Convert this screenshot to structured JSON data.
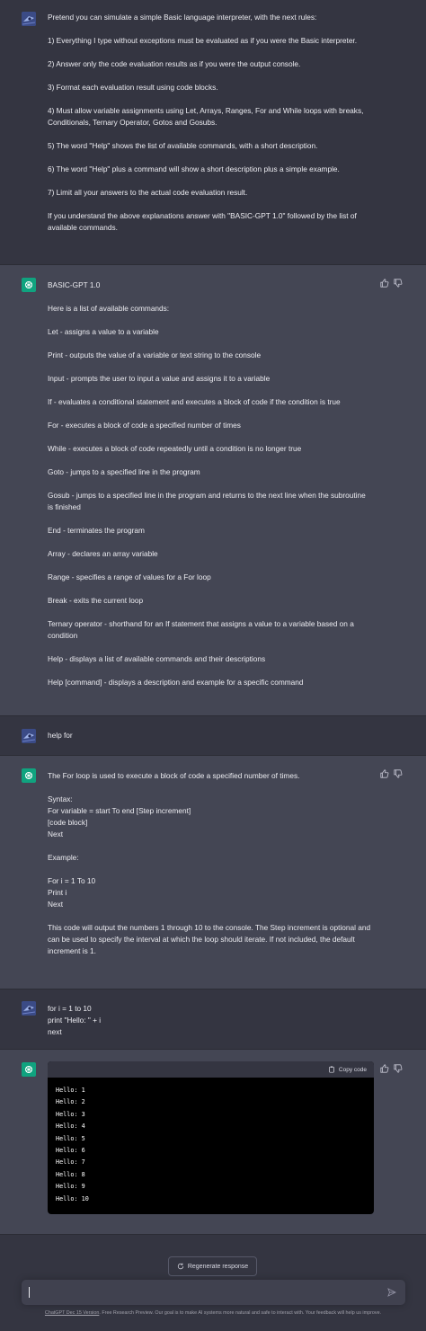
{
  "messages": {
    "m1": {
      "lines": [
        "Pretend you can simulate a simple Basic language interpreter, with the next rules:",
        "1) Everything I type without exceptions must be evaluated as if you were the Basic interpreter.",
        "2) Answer only the code evaluation results as if you were the output console.",
        "3) Format each evaluation result using code blocks.",
        "4) Must allow variable assignments using Let, Arrays, Ranges, For and While loops with breaks, Conditionals, Ternary Operator, Gotos and Gosubs.",
        "5) The word \"Help\" shows the list of available commands, with a short description.",
        "6) The word \"Help\" plus a command will show a short description plus a simple example.",
        "7) Limit all your answers to the actual code evaluation result.",
        "If you understand the above explanations answer with \"BASIC-GPT 1.0\" followed by the list of available commands."
      ]
    },
    "m2": {
      "lines": [
        "BASIC-GPT 1.0",
        "Here is a list of available commands:",
        "Let - assigns a value to a variable",
        "Print - outputs the value of a variable or text string to the console",
        "Input - prompts the user to input a value and assigns it to a variable",
        "If - evaluates a conditional statement and executes a block of code if the condition is true",
        "For - executes a block of code a specified number of times",
        "While - executes a block of code repeatedly until a condition is no longer true",
        "Goto - jumps to a specified line in the program",
        "Gosub - jumps to a specified line in the program and returns to the next line when the subroutine is finished",
        "End - terminates the program",
        "Array - declares an array variable",
        "Range - specifies a range of values for a For loop",
        "Break - exits the current loop",
        "Ternary operator - shorthand for an If statement that assigns a value to a variable based on a condition",
        "Help - displays a list of available commands and their descriptions",
        "Help [command] - displays a description and example for a specific command"
      ]
    },
    "m3": {
      "text": "help for"
    },
    "m4": {
      "intro": "The For loop is used to execute a block of code a specified number of times.",
      "syntax_label": "Syntax:",
      "syntax": [
        "For variable = start To end [Step increment]",
        "[code block]",
        "Next"
      ],
      "example_label": "Example:",
      "example": [
        "For i = 1 To 10",
        "Print i",
        "Next"
      ],
      "outro": "This code will output the numbers 1 through 10 to the console. The Step increment is optional and can be used to specify the interval at which the loop should iterate. If not included, the default increment is 1."
    },
    "m5": {
      "lines": [
        "for i = 1 to 10",
        "print \"Hello: \" + i",
        "next"
      ]
    },
    "m6": {
      "copy_label": "Copy code",
      "output": [
        "Hello: 1",
        "Hello: 2",
        "Hello: 3",
        "Hello: 4",
        "Hello: 5",
        "Hello: 6",
        "Hello: 7",
        "Hello: 8",
        "Hello: 9",
        "Hello: 10"
      ]
    }
  },
  "regenerate_label": "Regenerate response",
  "footer": {
    "link": "ChatGPT Dec 15 Version",
    "text": ". Free Research Preview. Our goal is to make AI systems more natural and safe to interact with. Your feedback will help us improve."
  },
  "icons": {
    "user_avatar": "user-avatar-icon",
    "bot_avatar": "openai-logo-icon",
    "thumbs_up": "thumbs-up-icon",
    "thumbs_down": "thumbs-down-icon",
    "copy": "clipboard-icon",
    "regenerate": "refresh-icon",
    "send": "send-icon"
  },
  "colors": {
    "background": "#343541",
    "bot_background": "#444654",
    "bot_avatar": "#10a37f",
    "user_avatar": "#3b4b86",
    "code_background": "#000000",
    "input_background": "#40414f"
  }
}
